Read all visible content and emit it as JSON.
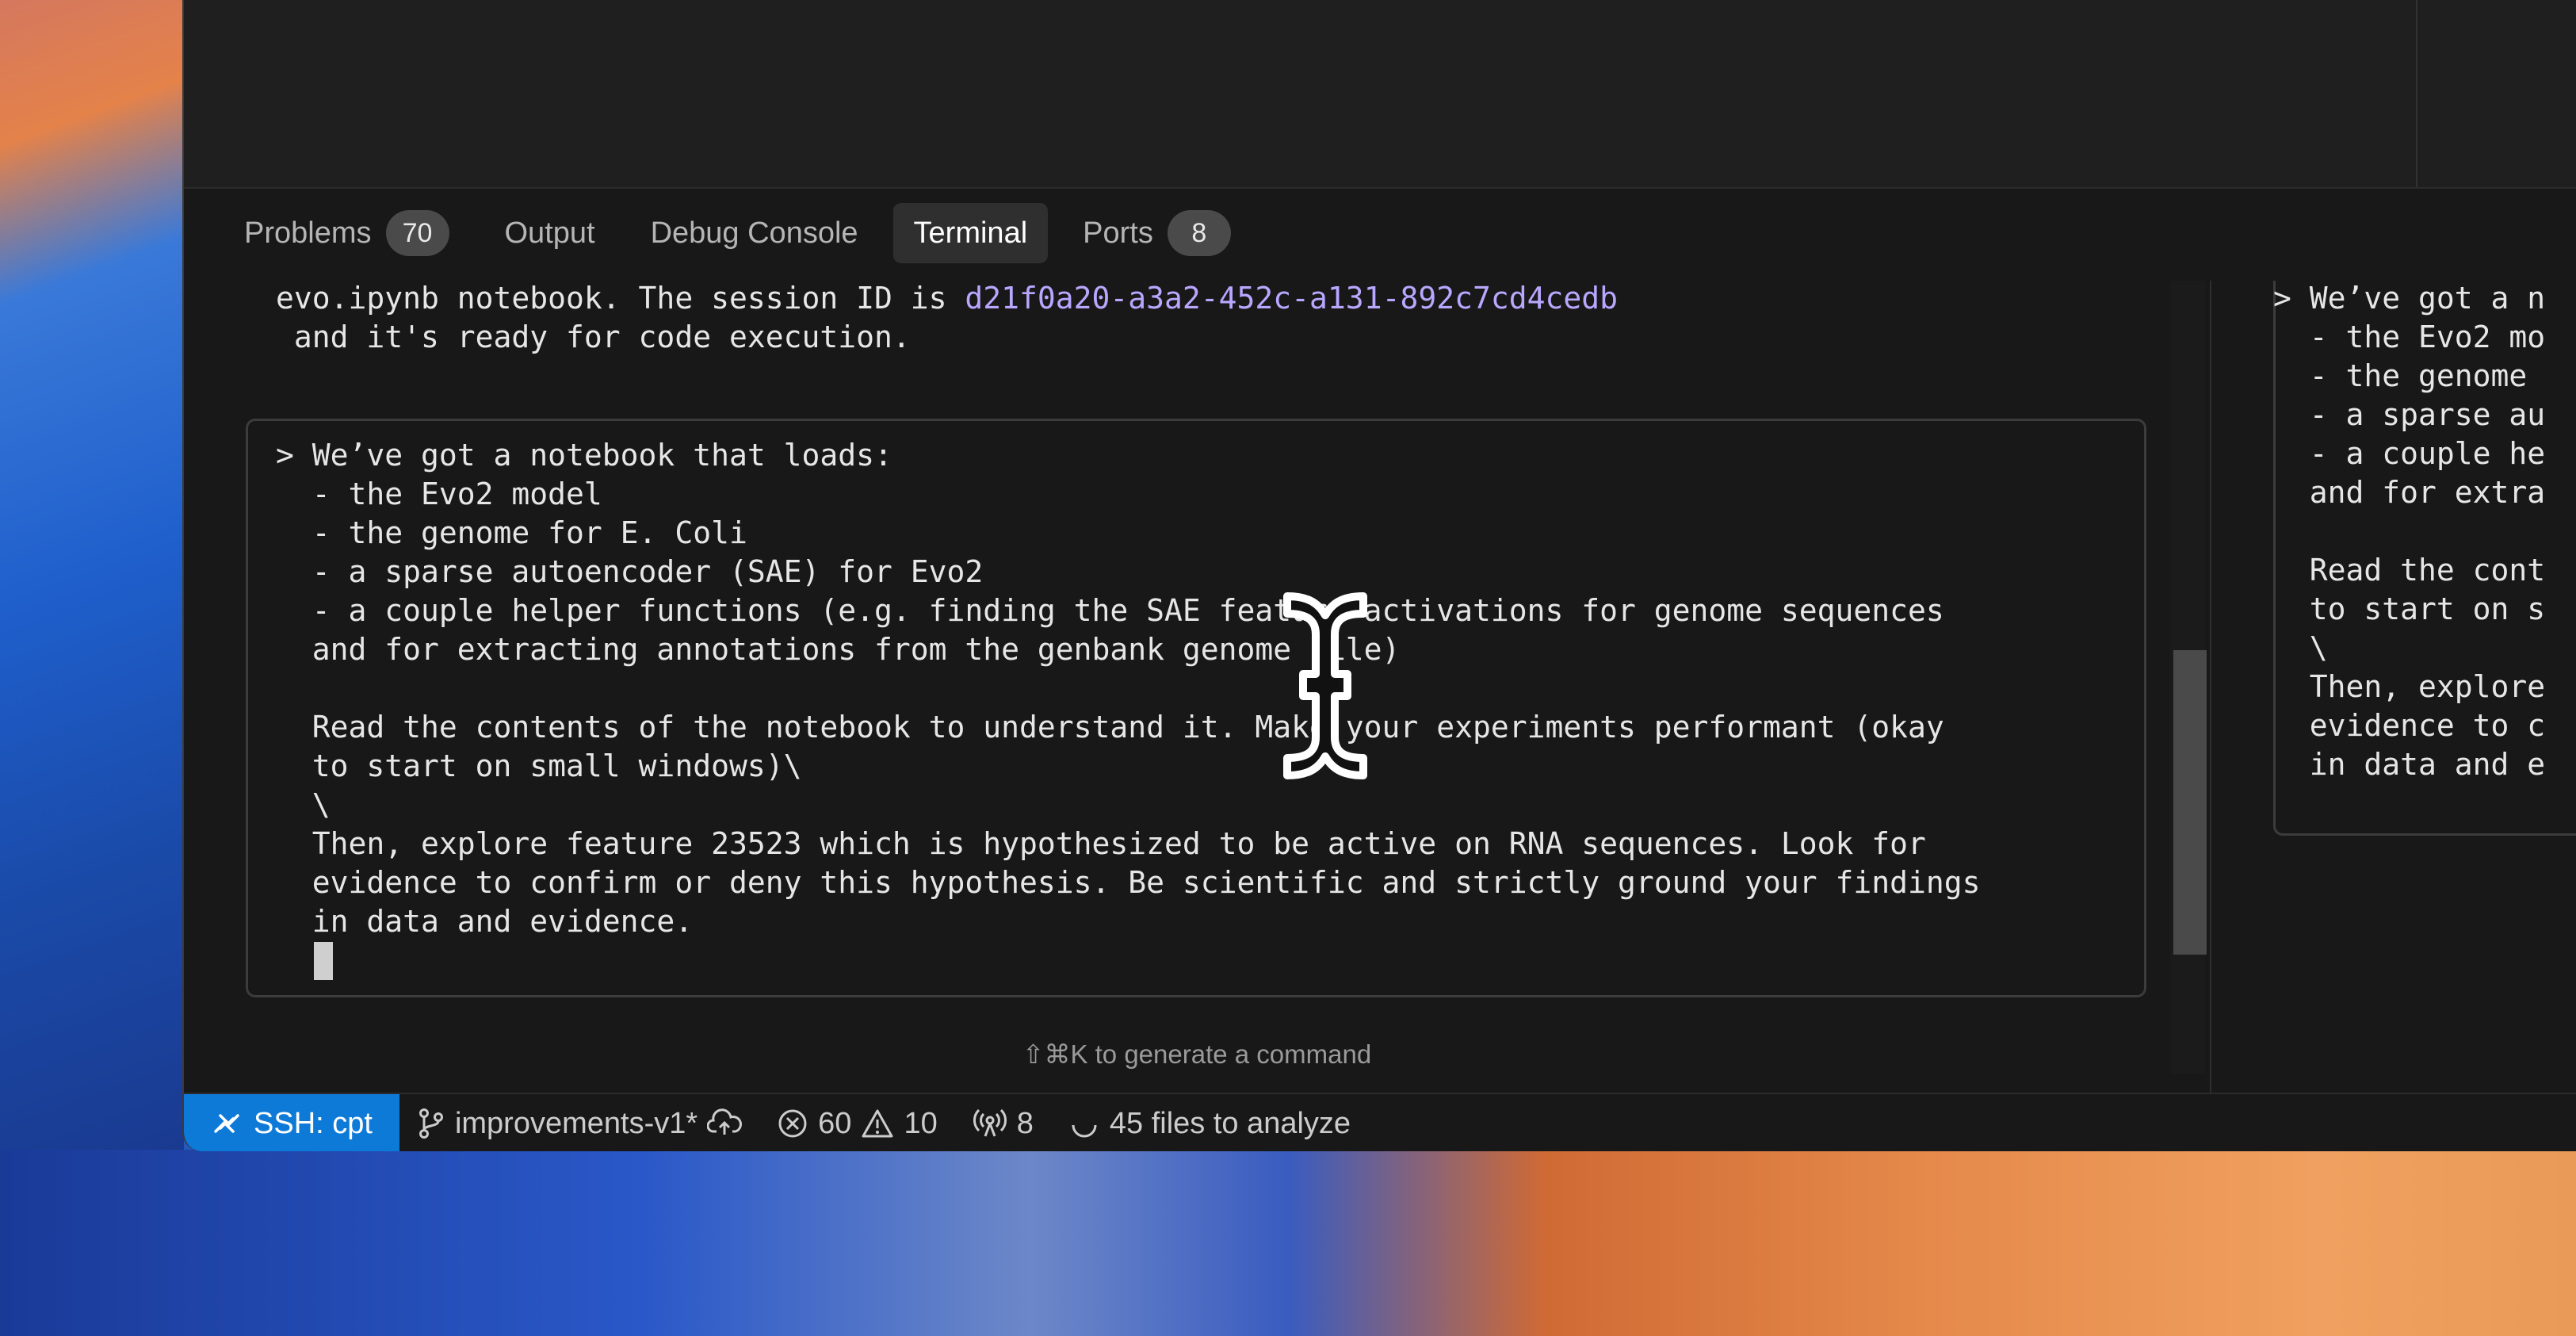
{
  "panel": {
    "tabs": [
      {
        "label": "Problems",
        "badge": "70"
      },
      {
        "label": "Output"
      },
      {
        "label": "Debug Console"
      },
      {
        "label": "Terminal",
        "active": true
      },
      {
        "label": "Ports",
        "badge": "8"
      }
    ]
  },
  "terminal": {
    "prev_line1_prefix": "evo.ipynb notebook. The session ID is ",
    "session_id": "d21f0a20-a3a2-452c-a131-892c7cd4cedb",
    "prev_line2": " and it's ready for code execution.",
    "prompt_lines": [
      "> We’ve got a notebook that loads:",
      "  - the Evo2 model",
      "  - the genome for E. Coli",
      "  - a sparse autoencoder (SAE) for Evo2",
      "  - a couple helper functions (e.g. finding the SAE feature activations for genome sequences",
      "  and for extracting annotations from the genbank genome file)",
      "",
      "  Read the contents of the notebook to understand it. Make your experiments performant (okay",
      "  to start on small windows)\\",
      "  \\",
      "  Then, explore feature 23523 which is hypothesized to be active on RNA sequences. Look for",
      "  evidence to confirm or deny this hypothesis. Be scientific and strictly ground your findings",
      "  in data and evidence."
    ],
    "hint": "⇧⌘K to generate a command"
  },
  "right_pane": {
    "lines": [
      "> We’ve got a n",
      "  - the Evo2 mo",
      "  - the genome ",
      "  - a sparse au",
      "  - a couple he",
      "  and for extra",
      "",
      "  Read the cont",
      "  to start on s",
      "  \\",
      "  Then, explore",
      "  evidence to c",
      "  in data and e"
    ]
  },
  "statusbar": {
    "remote": "SSH: cpt",
    "branch": "improvements-v1*",
    "errors": "60",
    "warnings": "10",
    "ports": "8",
    "analysis": "45 files to analyze"
  }
}
